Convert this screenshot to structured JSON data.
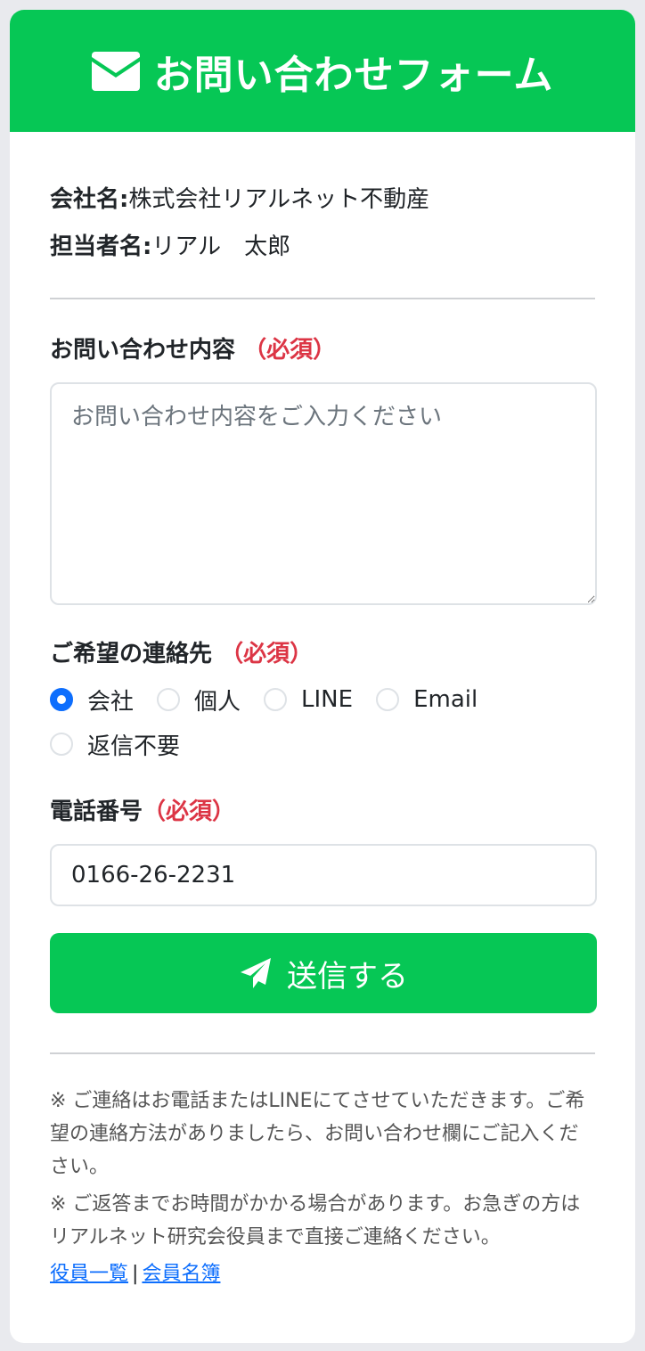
{
  "header": {
    "title": "お問い合わせフォーム",
    "icon": "envelope-icon",
    "color": "#06c755"
  },
  "company": {
    "label": "会社名:",
    "value": "株式会社リアルネット不動産"
  },
  "person": {
    "label": "担当者名:",
    "value": "リアル　太郎"
  },
  "inquiry": {
    "label": "お問い合わせ内容",
    "required": "（必須）",
    "placeholder": "お問い合わせ内容をご入力ください",
    "value": ""
  },
  "contact_method": {
    "label": "ご希望の連絡先",
    "required": "（必須）",
    "selected": "会社",
    "options": [
      "会社",
      "個人",
      "LINE",
      "Email",
      "返信不要"
    ]
  },
  "phone": {
    "label": "電話番号",
    "required": "（必須）",
    "value": "0166-26-2231"
  },
  "submit": {
    "label": "送信する",
    "icon": "paper-plane-icon"
  },
  "notes": [
    "※ ご連絡はお電話またはLINEにてさせていただきます。ご希望の連絡方法がありましたら、お問い合わせ欄にご記入ください。",
    "※ ご返答までお時間がかかる場合があります。お急ぎの方はリアルネット研究会役員まで直接ご連絡ください。"
  ],
  "links": {
    "officers": "役員一覧",
    "separator": "|",
    "directory": "会員名簿"
  },
  "colors": {
    "accent": "#06c755",
    "required": "#dc3545",
    "radio": "#0d6efd",
    "link": "#0d6efd"
  }
}
